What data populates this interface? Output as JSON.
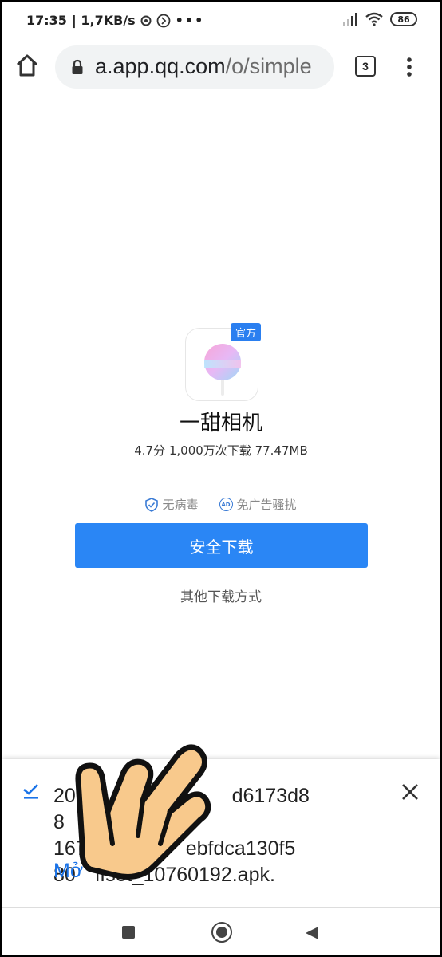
{
  "status_bar": {
    "time": "17:35",
    "net_speed": "| 1,7KB/s",
    "battery": "86"
  },
  "toolbar": {
    "url_domain": "a.app.qq.com",
    "url_path": "/o/simple",
    "tab_count": "3"
  },
  "app": {
    "badge": "官方",
    "name": "一甜相机",
    "meta": "4.7分  1,000万次下载  77.47MB",
    "features": [
      "无病毒",
      "免广告骚扰"
    ],
    "download_label": "安全下载",
    "other_methods": "其他下载方式"
  },
  "download": {
    "filename": "2021         d6173d88167        ebfdca130f580  ffset_10760192.apk.",
    "filename_lines": [
      "2021",
      "d6173d88",
      "167",
      "ebfdca130f5",
      "80",
      "ffset_10760192.apk."
    ],
    "open_label": "Mở"
  },
  "colors": {
    "accent": "#2a86f5",
    "badge": "#2a7ff0",
    "link": "#1a73e8"
  },
  "icons": {
    "home": "home-icon",
    "lock": "lock-icon",
    "menu": "more-vert-icon",
    "shield": "shield-check-icon",
    "ad": "ad-icon",
    "check": "download-done-icon",
    "close": "close-icon"
  }
}
